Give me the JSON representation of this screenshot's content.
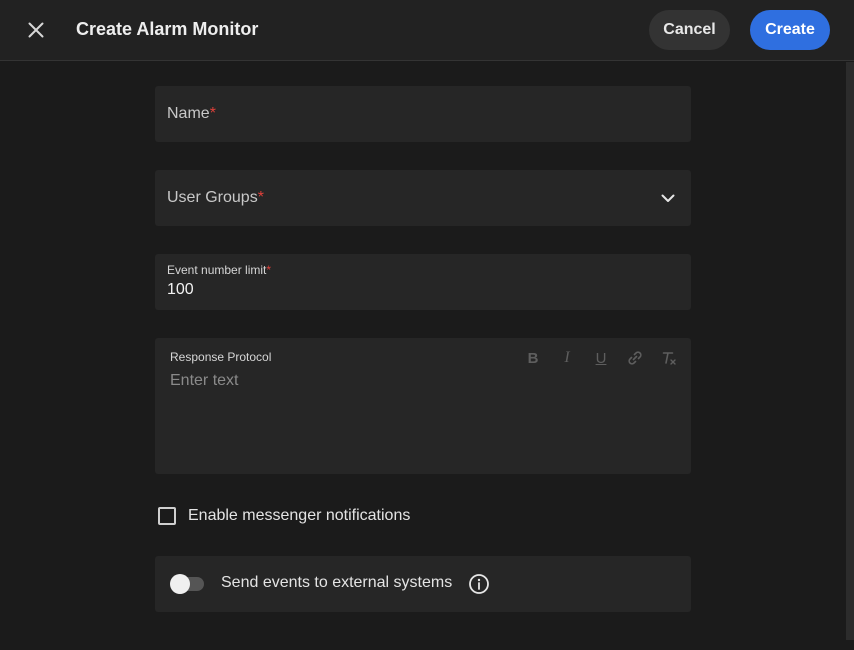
{
  "header": {
    "title": "Create Alarm Monitor",
    "cancel_label": "Cancel",
    "create_label": "Create"
  },
  "form": {
    "name": {
      "label": "Name",
      "required_mark": "*",
      "value": ""
    },
    "user_groups": {
      "label": "User Groups",
      "required_mark": "*",
      "value": ""
    },
    "event_limit": {
      "label": "Event number limit",
      "required_mark": "*",
      "value": "100"
    },
    "response_protocol": {
      "label": "Response Protocol",
      "placeholder": "Enter text",
      "toolbar": [
        "B",
        "I",
        "U",
        "link",
        "clear-format"
      ]
    },
    "messenger": {
      "label": "Enable messenger notifications",
      "checked": false
    },
    "external": {
      "label": "Send events to external systems",
      "enabled": false
    }
  },
  "colors": {
    "background": "#1b1b1b",
    "header": "#222222",
    "field": "#262626",
    "accent": "#2f6fe0",
    "required": "#e0413a"
  },
  "icons": {
    "close": "close-icon",
    "dropdown": "chevron-down-icon",
    "info": "info-icon",
    "bold": "bold-icon",
    "italic": "italic-icon",
    "underline": "underline-icon",
    "link": "link-icon",
    "clear": "clear-format-icon"
  }
}
